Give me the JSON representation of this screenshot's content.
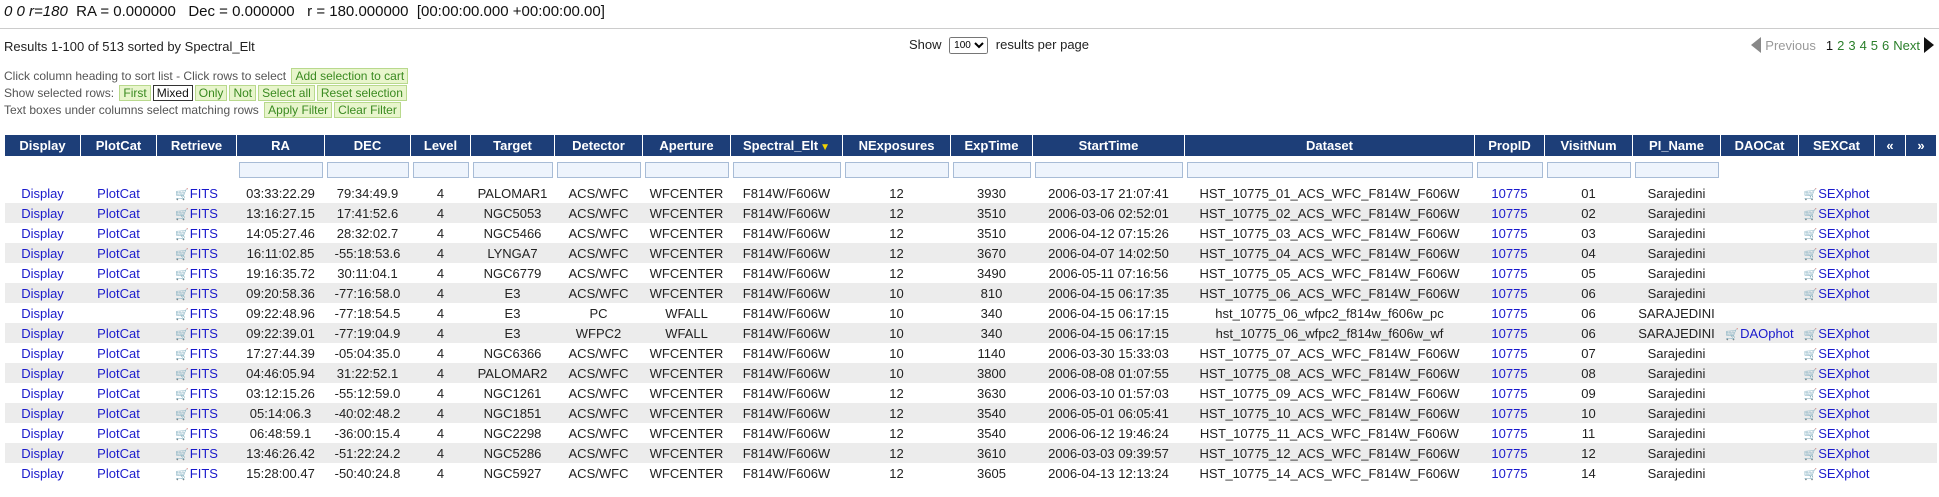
{
  "query": {
    "italic": "0 0 r=180",
    "rest": "  RA = 0.000000   Dec = 0.000000   r = 180.000000  [00:00:00.000 +00:00:00.00]"
  },
  "results": {
    "summary": "Results 1-100 of 513 sorted by Spectral_Elt",
    "show_label": "Show",
    "per_page_value": "100",
    "per_page_label": "results per page"
  },
  "pager": {
    "previous": "Previous",
    "current": "1",
    "pages": [
      "2",
      "3",
      "4",
      "5",
      "6"
    ],
    "next": "Next"
  },
  "controls": {
    "line1_text": "Click column heading to sort list - Click rows to select",
    "add_cart": "Add selection to cart",
    "line2_text": "Show selected rows:",
    "first": "First",
    "mixed": "Mixed",
    "only": "Only",
    "not": "Not",
    "select_all": "Select all",
    "reset": "Reset selection",
    "line3_text": "Text boxes under columns select matching rows",
    "apply": "Apply Filter",
    "clear": "Clear Filter"
  },
  "columns": [
    "Display",
    "PlotCat",
    "Retrieve",
    "RA",
    "DEC",
    "Level",
    "Target",
    "Detector",
    "Aperture",
    "Spectral_Elt",
    "NExposures",
    "ExpTime",
    "StartTime",
    "Dataset",
    "PropID",
    "VisitNum",
    "PI_Name",
    "DAOCat",
    "SEXCat",
    "«",
    "»"
  ],
  "rows": [
    {
      "display": "Display",
      "plotcat": "PlotCat",
      "retrieve": "FITS",
      "ra": "03:33:22.29",
      "dec": "79:34:49.9",
      "level": "4",
      "target": "PALOMAR1",
      "detector": "ACS/WFC",
      "aperture": "WFCENTER",
      "spectral": "F814W/F606W",
      "nexp": "12",
      "exptime": "3930",
      "start": "2006-03-17 21:07:41",
      "dataset": "HST_10775_01_ACS_WFC_F814W_F606W",
      "propid": "10775",
      "visit": "01",
      "pi": "Sarajedini",
      "daocat": "",
      "sexcat": "SEXphot"
    },
    {
      "display": "Display",
      "plotcat": "PlotCat",
      "retrieve": "FITS",
      "ra": "13:16:27.15",
      "dec": "17:41:52.6",
      "level": "4",
      "target": "NGC5053",
      "detector": "ACS/WFC",
      "aperture": "WFCENTER",
      "spectral": "F814W/F606W",
      "nexp": "12",
      "exptime": "3510",
      "start": "2006-03-06 02:52:01",
      "dataset": "HST_10775_02_ACS_WFC_F814W_F606W",
      "propid": "10775",
      "visit": "02",
      "pi": "Sarajedini",
      "daocat": "",
      "sexcat": "SEXphot"
    },
    {
      "display": "Display",
      "plotcat": "PlotCat",
      "retrieve": "FITS",
      "ra": "14:05:27.46",
      "dec": "28:32:02.7",
      "level": "4",
      "target": "NGC5466",
      "detector": "ACS/WFC",
      "aperture": "WFCENTER",
      "spectral": "F814W/F606W",
      "nexp": "12",
      "exptime": "3510",
      "start": "2006-04-12 07:15:26",
      "dataset": "HST_10775_03_ACS_WFC_F814W_F606W",
      "propid": "10775",
      "visit": "03",
      "pi": "Sarajedini",
      "daocat": "",
      "sexcat": "SEXphot"
    },
    {
      "display": "Display",
      "plotcat": "PlotCat",
      "retrieve": "FITS",
      "ra": "16:11:02.85",
      "dec": "-55:18:53.6",
      "level": "4",
      "target": "LYNGA7",
      "detector": "ACS/WFC",
      "aperture": "WFCENTER",
      "spectral": "F814W/F606W",
      "nexp": "12",
      "exptime": "3670",
      "start": "2006-04-07 14:02:50",
      "dataset": "HST_10775_04_ACS_WFC_F814W_F606W",
      "propid": "10775",
      "visit": "04",
      "pi": "Sarajedini",
      "daocat": "",
      "sexcat": "SEXphot"
    },
    {
      "display": "Display",
      "plotcat": "PlotCat",
      "retrieve": "FITS",
      "ra": "19:16:35.72",
      "dec": "30:11:04.1",
      "level": "4",
      "target": "NGC6779",
      "detector": "ACS/WFC",
      "aperture": "WFCENTER",
      "spectral": "F814W/F606W",
      "nexp": "12",
      "exptime": "3490",
      "start": "2006-05-11 07:16:56",
      "dataset": "HST_10775_05_ACS_WFC_F814W_F606W",
      "propid": "10775",
      "visit": "05",
      "pi": "Sarajedini",
      "daocat": "",
      "sexcat": "SEXphot"
    },
    {
      "display": "Display",
      "plotcat": "PlotCat",
      "retrieve": "FITS",
      "ra": "09:20:58.36",
      "dec": "-77:16:58.0",
      "level": "4",
      "target": "E3",
      "detector": "ACS/WFC",
      "aperture": "WFCENTER",
      "spectral": "F814W/F606W",
      "nexp": "10",
      "exptime": "810",
      "start": "2006-04-15 06:17:35",
      "dataset": "HST_10775_06_ACS_WFC_F814W_F606W",
      "propid": "10775",
      "visit": "06",
      "pi": "Sarajedini",
      "daocat": "",
      "sexcat": "SEXphot"
    },
    {
      "display": "Display",
      "plotcat": "",
      "retrieve": "FITS",
      "ra": "09:22:48.96",
      "dec": "-77:18:54.5",
      "level": "4",
      "target": "E3",
      "detector": "PC",
      "aperture": "WFALL",
      "spectral": "F814W/F606W",
      "nexp": "10",
      "exptime": "340",
      "start": "2006-04-15 06:17:15",
      "dataset": "hst_10775_06_wfpc2_f814w_f606w_pc",
      "propid": "10775",
      "visit": "06",
      "pi": "SARAJEDINI",
      "daocat": "",
      "sexcat": ""
    },
    {
      "display": "Display",
      "plotcat": "PlotCat",
      "retrieve": "FITS",
      "ra": "09:22:39.01",
      "dec": "-77:19:04.9",
      "level": "4",
      "target": "E3",
      "detector": "WFPC2",
      "aperture": "WFALL",
      "spectral": "F814W/F606W",
      "nexp": "10",
      "exptime": "340",
      "start": "2006-04-15 06:17:15",
      "dataset": "hst_10775_06_wfpc2_f814w_f606w_wf",
      "propid": "10775",
      "visit": "06",
      "pi": "SARAJEDINI",
      "daocat": "DAOphot",
      "sexcat": "SEXphot"
    },
    {
      "display": "Display",
      "plotcat": "PlotCat",
      "retrieve": "FITS",
      "ra": "17:27:44.39",
      "dec": "-05:04:35.0",
      "level": "4",
      "target": "NGC6366",
      "detector": "ACS/WFC",
      "aperture": "WFCENTER",
      "spectral": "F814W/F606W",
      "nexp": "10",
      "exptime": "1140",
      "start": "2006-03-30 15:33:03",
      "dataset": "HST_10775_07_ACS_WFC_F814W_F606W",
      "propid": "10775",
      "visit": "07",
      "pi": "Sarajedini",
      "daocat": "",
      "sexcat": "SEXphot"
    },
    {
      "display": "Display",
      "plotcat": "PlotCat",
      "retrieve": "FITS",
      "ra": "04:46:05.94",
      "dec": "31:22:52.1",
      "level": "4",
      "target": "PALOMAR2",
      "detector": "ACS/WFC",
      "aperture": "WFCENTER",
      "spectral": "F814W/F606W",
      "nexp": "10",
      "exptime": "3800",
      "start": "2006-08-08 01:07:55",
      "dataset": "HST_10775_08_ACS_WFC_F814W_F606W",
      "propid": "10775",
      "visit": "08",
      "pi": "Sarajedini",
      "daocat": "",
      "sexcat": "SEXphot"
    },
    {
      "display": "Display",
      "plotcat": "PlotCat",
      "retrieve": "FITS",
      "ra": "03:12:15.26",
      "dec": "-55:12:59.0",
      "level": "4",
      "target": "NGC1261",
      "detector": "ACS/WFC",
      "aperture": "WFCENTER",
      "spectral": "F814W/F606W",
      "nexp": "12",
      "exptime": "3630",
      "start": "2006-03-10 01:57:03",
      "dataset": "HST_10775_09_ACS_WFC_F814W_F606W",
      "propid": "10775",
      "visit": "09",
      "pi": "Sarajedini",
      "daocat": "",
      "sexcat": "SEXphot"
    },
    {
      "display": "Display",
      "plotcat": "PlotCat",
      "retrieve": "FITS",
      "ra": "05:14:06.3",
      "dec": "-40:02:48.2",
      "level": "4",
      "target": "NGC1851",
      "detector": "ACS/WFC",
      "aperture": "WFCENTER",
      "spectral": "F814W/F606W",
      "nexp": "12",
      "exptime": "3540",
      "start": "2006-05-01 06:05:41",
      "dataset": "HST_10775_10_ACS_WFC_F814W_F606W",
      "propid": "10775",
      "visit": "10",
      "pi": "Sarajedini",
      "daocat": "",
      "sexcat": "SEXphot"
    },
    {
      "display": "Display",
      "plotcat": "PlotCat",
      "retrieve": "FITS",
      "ra": "06:48:59.1",
      "dec": "-36:00:15.4",
      "level": "4",
      "target": "NGC2298",
      "detector": "ACS/WFC",
      "aperture": "WFCENTER",
      "spectral": "F814W/F606W",
      "nexp": "12",
      "exptime": "3540",
      "start": "2006-06-12 19:46:24",
      "dataset": "HST_10775_11_ACS_WFC_F814W_F606W",
      "propid": "10775",
      "visit": "11",
      "pi": "Sarajedini",
      "daocat": "",
      "sexcat": "SEXphot"
    },
    {
      "display": "Display",
      "plotcat": "PlotCat",
      "retrieve": "FITS",
      "ra": "13:46:26.42",
      "dec": "-51:22:24.2",
      "level": "4",
      "target": "NGC5286",
      "detector": "ACS/WFC",
      "aperture": "WFCENTER",
      "spectral": "F814W/F606W",
      "nexp": "12",
      "exptime": "3610",
      "start": "2006-03-03 09:39:57",
      "dataset": "HST_10775_12_ACS_WFC_F814W_F606W",
      "propid": "10775",
      "visit": "12",
      "pi": "Sarajedini",
      "daocat": "",
      "sexcat": "SEXphot"
    },
    {
      "display": "Display",
      "plotcat": "PlotCat",
      "retrieve": "FITS",
      "ra": "15:28:00.47",
      "dec": "-50:40:24.8",
      "level": "4",
      "target": "NGC5927",
      "detector": "ACS/WFC",
      "aperture": "WFCENTER",
      "spectral": "F814W/F606W",
      "nexp": "12",
      "exptime": "3605",
      "start": "2006-04-13 12:13:24",
      "dataset": "HST_10775_14_ACS_WFC_F814W_F606W",
      "propid": "10775",
      "visit": "14",
      "pi": "Sarajedini",
      "daocat": "",
      "sexcat": "SEXphot"
    }
  ]
}
